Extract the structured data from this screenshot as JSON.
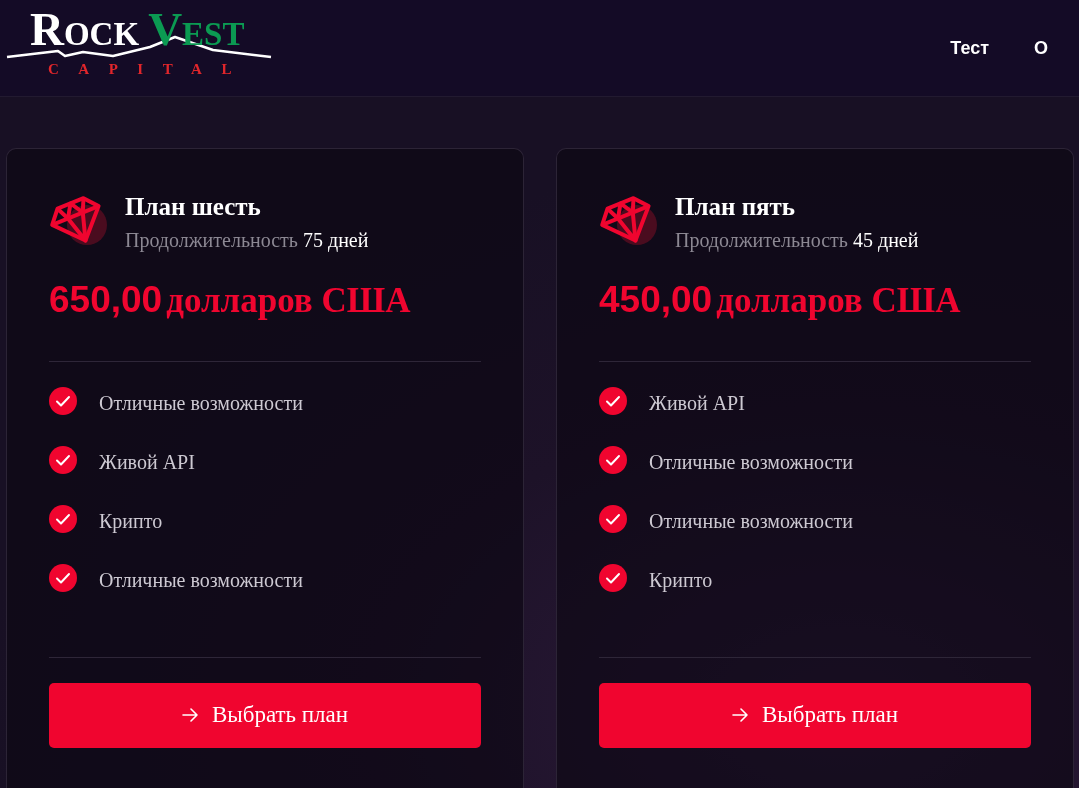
{
  "header": {
    "logo": {
      "word_1": "ROCK",
      "word_2": "VEST",
      "tagline": "CAPITAL"
    },
    "nav": [
      "Тест",
      "О"
    ]
  },
  "plans": [
    {
      "title": "План шесть",
      "duration_label": "Продолжительность",
      "duration": "75 дней",
      "amount": "650,00",
      "currency": "долларов США",
      "features": [
        "Отличные возможности",
        "Живой API",
        "Крипто",
        "Отличные возможности"
      ],
      "button": "Выбрать план"
    },
    {
      "title": "План пять",
      "duration_label": "Продолжительность",
      "duration": "45 дней",
      "amount": "450,00",
      "currency": "долларов США",
      "features": [
        "Живой API",
        "Отличные возможности",
        "Отличные возможности",
        "Крипто"
      ],
      "button": "Выбрать план"
    }
  ]
}
